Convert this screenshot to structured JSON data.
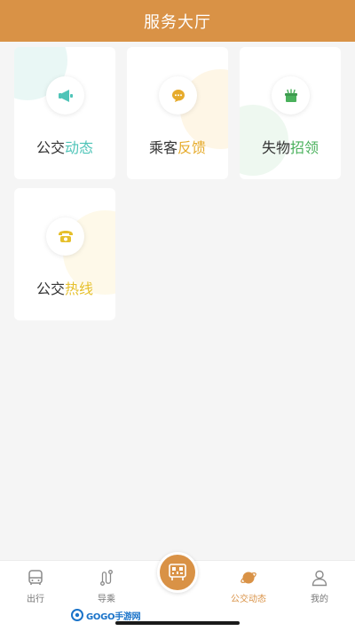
{
  "header": {
    "title": "服务大厅"
  },
  "cards": [
    {
      "label_plain": "公交",
      "label_accent": "动态",
      "accent_color": "#4fc4b8",
      "icon": "megaphone-icon"
    },
    {
      "label_plain": "乘客",
      "label_accent": "反馈",
      "accent_color": "#e6ab2c",
      "icon": "chat-bubble-icon"
    },
    {
      "label_plain": "失物",
      "label_accent": "招领",
      "accent_color": "#4ab15c",
      "icon": "lost-found-box-icon"
    },
    {
      "label_plain": "公交",
      "label_accent": "热线",
      "accent_color": "#e6c02c",
      "icon": "telephone-icon"
    }
  ],
  "tabbar": {
    "tabs": [
      {
        "label": "出行",
        "icon": "bus-icon",
        "active": false
      },
      {
        "label": "导乘",
        "icon": "route-icon",
        "active": false
      },
      {
        "label": "公交动态",
        "icon": "planet-icon",
        "active": true
      },
      {
        "label": "我的",
        "icon": "person-icon",
        "active": false
      }
    ],
    "center_icon": "qr-bus-code-icon"
  },
  "watermark": {
    "text": "GOGO手游网"
  },
  "colors": {
    "brand": "#d99246",
    "background": "#f5f5f5"
  }
}
